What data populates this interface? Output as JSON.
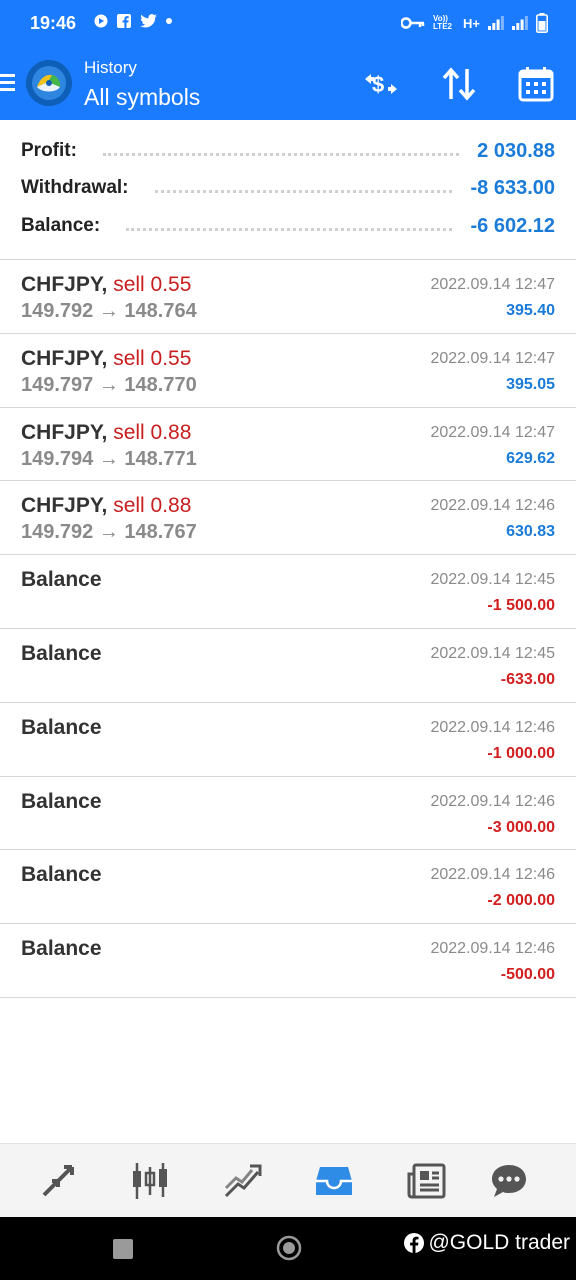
{
  "status": {
    "time": "19:46",
    "network": "H+",
    "lte": "Vo)) LTE2"
  },
  "header": {
    "subtitle": "History",
    "title": "All symbols",
    "actions": [
      "currency-exchange-icon",
      "sort-icon",
      "calendar-icon"
    ]
  },
  "summary": {
    "profit_label": "Profit:",
    "profit_value": "2 030.88",
    "withdrawal_label": "Withdrawal:",
    "withdrawal_value": "-8 633.00",
    "balance_label": "Balance:",
    "balance_value": "-6 602.12"
  },
  "deals": [
    {
      "symbol": "CHFJPY,",
      "action": "sell 0.55",
      "prices": "149.792 → 148.764",
      "date": "2022.09.14 12:47",
      "profit": "395.40"
    },
    {
      "symbol": "CHFJPY,",
      "action": "sell 0.55",
      "prices": "149.797 → 148.770",
      "date": "2022.09.14 12:47",
      "profit": "395.05"
    },
    {
      "symbol": "CHFJPY,",
      "action": "sell 0.88",
      "prices": "149.794 → 148.771",
      "date": "2022.09.14 12:47",
      "profit": "629.62"
    },
    {
      "symbol": "CHFJPY,",
      "action": "sell 0.88",
      "prices": "149.792 → 148.767",
      "date": "2022.09.14 12:46",
      "profit": "630.83"
    }
  ],
  "balances": [
    {
      "label": "Balance",
      "date": "2022.09.14 12:45",
      "amount": "-1 500.00"
    },
    {
      "label": "Balance",
      "date": "2022.09.14 12:45",
      "amount": "-633.00"
    },
    {
      "label": "Balance",
      "date": "2022.09.14 12:46",
      "amount": "-1 000.00"
    },
    {
      "label": "Balance",
      "date": "2022.09.14 12:46",
      "amount": "-3 000.00"
    },
    {
      "label": "Balance",
      "date": "2022.09.14 12:46",
      "amount": "-2 000.00"
    },
    {
      "label": "Balance",
      "date": "2022.09.14 12:46",
      "amount": "-500.00"
    }
  ],
  "bottom_nav": [
    "quotes-icon",
    "chart-icon",
    "trade-icon",
    "history-icon",
    "news-icon",
    "chat-icon"
  ],
  "watermark": "@GOLD trader",
  "colors": {
    "accent": "#1a7bff",
    "positive": "#1a7bd8",
    "negative": "#d21e1e"
  }
}
